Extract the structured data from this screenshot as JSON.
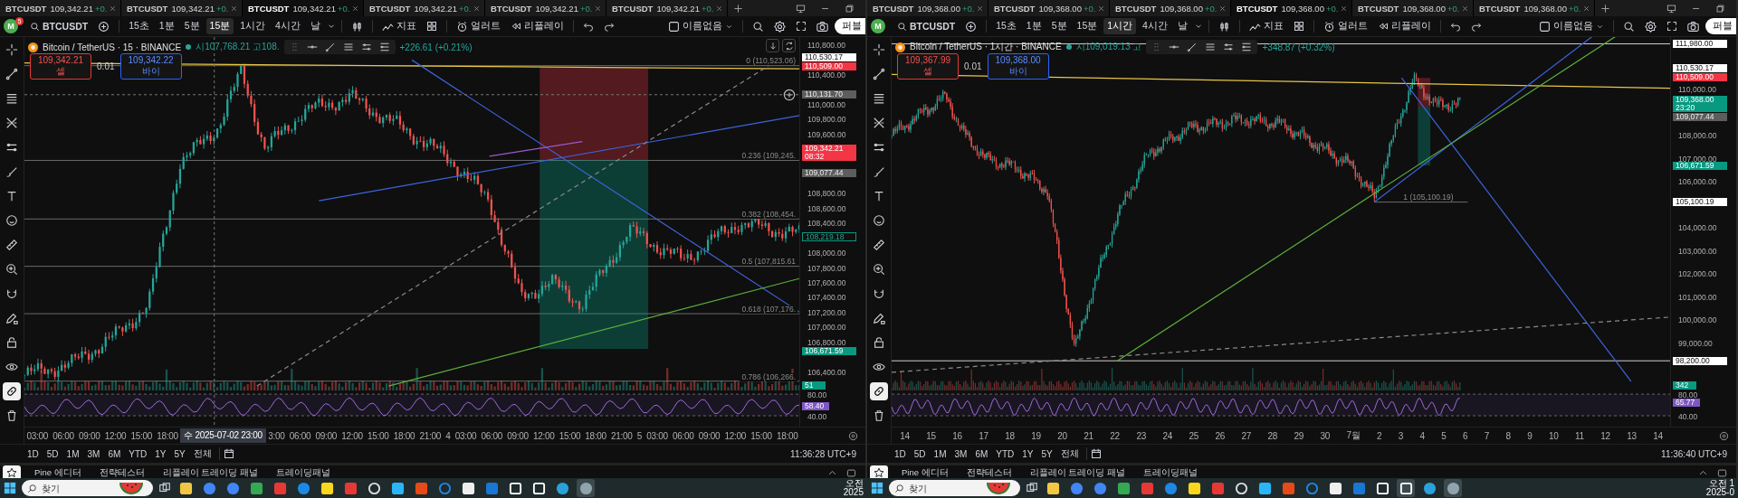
{
  "panes": [
    {
      "tabs": [
        {
          "symbol": "BTCUSDT",
          "price": "109,342.21",
          "change": "+0.",
          "selected": false
        },
        {
          "symbol": "BTCUSDT",
          "price": "109,342.21",
          "change": "+0.",
          "selected": false
        },
        {
          "symbol": "BTCUSDT",
          "price": "109,342.21",
          "change": "+0.",
          "selected": true
        },
        {
          "symbol": "BTCUSDT",
          "price": "109,342.21",
          "change": "+0.",
          "selected": false
        },
        {
          "symbol": "BTCUSDT",
          "price": "109,342.21",
          "change": "+0.",
          "selected": false
        },
        {
          "symbol": "BTCUSDT",
          "price": "109,342.21",
          "change": "+0.",
          "selected": false
        }
      ],
      "toolbar": {
        "avatar": "M",
        "badge": "5",
        "symbol": "BTCUSDT",
        "indicators": "지표",
        "alerts": "얼러트",
        "replay": "리플레이",
        "layout_name": "이름없음",
        "publish": "퍼블",
        "intervals": [
          {
            "label": "15초",
            "selected": false
          },
          {
            "label": "1분",
            "selected": false
          },
          {
            "label": "5분",
            "selected": false
          },
          {
            "label": "15분",
            "selected": true
          },
          {
            "label": "1시간",
            "selected": false
          },
          {
            "label": "4시간",
            "selected": false
          },
          {
            "label": "날",
            "selected": false
          }
        ]
      },
      "tools": [
        {
          "kind": "crosshair",
          "selected": false
        },
        {
          "kind": "line",
          "selected": false
        },
        {
          "kind": "fib",
          "selected": false
        },
        {
          "kind": "pitchfork",
          "selected": false
        },
        {
          "kind": "channel",
          "selected": false
        },
        {
          "kind": "brush",
          "selected": false
        },
        {
          "kind": "text",
          "selected": false
        },
        {
          "kind": "emoji",
          "selected": false
        },
        {
          "kind": "ruler",
          "selected": false
        },
        {
          "kind": "zoom",
          "selected": false
        },
        {
          "kind": "magnet",
          "selected": false
        },
        {
          "kind": "pencil",
          "selected": false
        },
        {
          "kind": "lock",
          "selected": false
        },
        {
          "kind": "eye",
          "selected": false
        },
        {
          "kind": "link",
          "selected": true
        },
        {
          "kind": "trash",
          "selected": false
        }
      ],
      "legend": {
        "title": "Bitcoin / TetherUS · 15 · BINANCE",
        "ohlc": "시107,768.21 고108.",
        "change": "+226.61 (+0.21%)"
      },
      "orders": {
        "sell_price": "109,342.21",
        "sell_label": "셀",
        "quantity": "0.01",
        "buy_price": "109,342.22",
        "buy_label": "바이"
      },
      "fib_labels": [
        {
          "text": "0 (110,523.06)"
        },
        {
          "text": "0.236 (109,245."
        },
        {
          "text": "0.382 (108,454."
        },
        {
          "text": "0.5 (107,815.61"
        },
        {
          "text": "0.618 (107,176."
        },
        {
          "text": "0.786 (106,266."
        }
      ],
      "price_ticks": [
        "110,800.00",
        "110,400.00",
        "110,000.00",
        "109,800.00",
        "109,600.00",
        "108,800.00",
        "108,600.00",
        "108,400.00",
        "108,000.00",
        "107,800.00",
        "107,600.00",
        "107,400.00",
        "107,200.00",
        "107,000.00",
        "106,800.00",
        "106,400.00"
      ],
      "price_labels": [
        {
          "text": "110,530.17",
          "kind": "white"
        },
        {
          "text": "110,509.00",
          "kind": "red"
        },
        {
          "text": "110,131.70",
          "kind": "gray"
        },
        {
          "text": "109,342.21",
          "sub": "08:32",
          "kind": "red"
        },
        {
          "text": "109,077.44",
          "kind": "gray"
        },
        {
          "text": "108,219.18",
          "kind": "outline"
        },
        {
          "text": "106,671.59",
          "kind": "green"
        }
      ],
      "volume_label": "51",
      "rsi": {
        "ticks": [
          "80.00",
          "40.00"
        ],
        "value": "58.40"
      },
      "time_axis": [
        {
          "text": "03:00",
          "kind": "tick"
        },
        {
          "text": "06:00",
          "kind": "tick"
        },
        {
          "text": "09:00",
          "kind": "tick"
        },
        {
          "text": "12:00",
          "kind": "tick"
        },
        {
          "text": "15:00",
          "kind": "tick"
        },
        {
          "text": "18:00",
          "kind": "tick"
        },
        {
          "text": "수 2025-07-02  23:00",
          "kind": "crosshair"
        },
        {
          "text": "3:00",
          "kind": "tick"
        },
        {
          "text": "06:00",
          "kind": "tick"
        },
        {
          "text": "09:00",
          "kind": "tick"
        },
        {
          "text": "12:00",
          "kind": "tick"
        },
        {
          "text": "15:00",
          "kind": "tick"
        },
        {
          "text": "18:00",
          "kind": "tick"
        },
        {
          "text": "21:00",
          "kind": "tick"
        },
        {
          "text": "4",
          "kind": "tick"
        },
        {
          "text": "03:00",
          "kind": "tick"
        },
        {
          "text": "06:00",
          "kind": "tick"
        },
        {
          "text": "09:00",
          "kind": "tick"
        },
        {
          "text": "12:00",
          "kind": "tick"
        },
        {
          "text": "15:00",
          "kind": "tick"
        },
        {
          "text": "18:00",
          "kind": "tick"
        },
        {
          "text": "21:00",
          "kind": "tick"
        },
        {
          "text": "5",
          "kind": "tick"
        },
        {
          "text": "03:00",
          "kind": "tick"
        },
        {
          "text": "06:00",
          "kind": "tick"
        },
        {
          "text": "09:00",
          "kind": "tick"
        },
        {
          "text": "12:00",
          "kind": "tick"
        },
        {
          "text": "15:00",
          "kind": "tick"
        },
        {
          "text": "18:00",
          "kind": "tick"
        }
      ],
      "ranges": [
        "1D",
        "5D",
        "1M",
        "3M",
        "6M",
        "YTD",
        "1Y",
        "5Y",
        "전체"
      ],
      "clock": "11:36:28 UTC+9",
      "panel_tabs": [
        "Pine 에디터",
        "전략테스터",
        "리플레이 트레이딩 패널",
        "트레이딩패널"
      ],
      "taskbar": {
        "search_placeholder": "찾기",
        "time": "오전",
        "date": "2025",
        "apps": [
          {
            "selected": false
          },
          {
            "selected": false
          },
          {
            "selected": false
          },
          {
            "selected": false
          },
          {
            "selected": false
          },
          {
            "selected": false
          },
          {
            "selected": false
          },
          {
            "selected": false
          },
          {
            "selected": false
          },
          {
            "selected": false
          },
          {
            "selected": false
          },
          {
            "selected": false
          },
          {
            "selected": false
          },
          {
            "selected": false
          },
          {
            "selected": false
          },
          {
            "selected": false
          },
          {
            "selected": false
          },
          {
            "selected": true
          }
        ]
      }
    },
    {
      "tabs": [
        {
          "symbol": "BTCUSDT",
          "price": "109,368.00",
          "change": "+0.",
          "selected": false
        },
        {
          "symbol": "BTCUSDT",
          "price": "109,368.00",
          "change": "+0.",
          "selected": false
        },
        {
          "symbol": "BTCUSDT",
          "price": "109,368.00",
          "change": "+0.",
          "selected": false
        },
        {
          "symbol": "BTCUSDT",
          "price": "109,368.00",
          "change": "+0.",
          "selected": true
        },
        {
          "symbol": "BTCUSDT",
          "price": "109,368.00",
          "change": "+0.",
          "selected": false
        },
        {
          "symbol": "BTCUSDT",
          "price": "109,368.00",
          "change": "+0.",
          "selected": false
        }
      ],
      "toolbar": {
        "avatar": "M",
        "symbol": "BTCUSDT",
        "indicators": "지표",
        "alerts": "얼러트",
        "replay": "리플레이",
        "layout_name": "이름없음",
        "publish": "퍼블",
        "intervals": [
          {
            "label": "15초",
            "selected": false
          },
          {
            "label": "1분",
            "selected": false
          },
          {
            "label": "5분",
            "selected": false
          },
          {
            "label": "15분",
            "selected": false
          },
          {
            "label": "1시간",
            "selected": true
          },
          {
            "label": "4시간",
            "selected": false
          },
          {
            "label": "날",
            "selected": false
          }
        ]
      },
      "tools": [
        {
          "kind": "crosshair",
          "selected": false
        },
        {
          "kind": "line",
          "selected": false
        },
        {
          "kind": "fib",
          "selected": false
        },
        {
          "kind": "pitchfork",
          "selected": false
        },
        {
          "kind": "channel",
          "selected": false
        },
        {
          "kind": "brush",
          "selected": false
        },
        {
          "kind": "text",
          "selected": false
        },
        {
          "kind": "emoji",
          "selected": false
        },
        {
          "kind": "ruler",
          "selected": false
        },
        {
          "kind": "zoom",
          "selected": false
        },
        {
          "kind": "magnet",
          "selected": false
        },
        {
          "kind": "pencil",
          "selected": false
        },
        {
          "kind": "lock",
          "selected": false
        },
        {
          "kind": "eye",
          "selected": false
        },
        {
          "kind": "link",
          "selected": true
        },
        {
          "kind": "trash",
          "selected": false
        }
      ],
      "legend": {
        "title": "Bitcoin / TetherUS · 1시간 · BINANCE",
        "ohlc": "시109,019.13 고",
        "change": "+348.87 (+0.32%)"
      },
      "orders": {
        "sell_price": "109,367.99",
        "sell_label": "셀",
        "quantity": "0.01",
        "buy_price": "109,368.00",
        "buy_label": "바이"
      },
      "fib_labels": [
        {
          "text": "1 (105,100.19)"
        }
      ],
      "price_ticks": [
        "110,000.00",
        "108,000.00",
        "107,000.00",
        "106,000.00",
        "104,000.00",
        "103,000.00",
        "102,000.00",
        "101,000.00",
        "100,000.00",
        "99,000.00"
      ],
      "price_labels": [
        {
          "text": "111,980.00",
          "kind": "white"
        },
        {
          "text": "110,530.17",
          "kind": "white"
        },
        {
          "text": "110,509.00",
          "kind": "red"
        },
        {
          "text": "109,368.00",
          "sub": "23:20",
          "kind": "green"
        },
        {
          "text": "109,077.44",
          "kind": "gray"
        },
        {
          "text": "106,671.59",
          "kind": "green"
        },
        {
          "text": "105,100.19",
          "kind": "white"
        },
        {
          "text": "98,200.00",
          "kind": "white"
        }
      ],
      "volume_label": "342",
      "rsi": {
        "ticks": [
          "80.00",
          "40.00"
        ],
        "value": "65.77"
      },
      "time_axis": [
        {
          "text": "14",
          "kind": "tick"
        },
        {
          "text": "15",
          "kind": "tick"
        },
        {
          "text": "16",
          "kind": "tick"
        },
        {
          "text": "17",
          "kind": "tick"
        },
        {
          "text": "18",
          "kind": "tick"
        },
        {
          "text": "19",
          "kind": "tick"
        },
        {
          "text": "20",
          "kind": "tick"
        },
        {
          "text": "21",
          "kind": "tick"
        },
        {
          "text": "22",
          "kind": "tick"
        },
        {
          "text": "23",
          "kind": "tick"
        },
        {
          "text": "24",
          "kind": "tick"
        },
        {
          "text": "25",
          "kind": "tick"
        },
        {
          "text": "26",
          "kind": "tick"
        },
        {
          "text": "27",
          "kind": "tick"
        },
        {
          "text": "28",
          "kind": "tick"
        },
        {
          "text": "29",
          "kind": "tick"
        },
        {
          "text": "30",
          "kind": "tick"
        },
        {
          "text": "7월",
          "kind": "tick"
        },
        {
          "text": "2",
          "kind": "tick"
        },
        {
          "text": "3",
          "kind": "tick"
        },
        {
          "text": "4",
          "kind": "tick"
        },
        {
          "text": "5",
          "kind": "tick"
        },
        {
          "text": "6",
          "kind": "tick"
        },
        {
          "text": "7",
          "kind": "tick"
        },
        {
          "text": "8",
          "kind": "tick"
        },
        {
          "text": "9",
          "kind": "tick"
        },
        {
          "text": "10",
          "kind": "tick"
        },
        {
          "text": "11",
          "kind": "tick"
        },
        {
          "text": "12",
          "kind": "tick"
        },
        {
          "text": "13",
          "kind": "tick"
        },
        {
          "text": "14",
          "kind": "tick"
        }
      ],
      "ranges": [
        "1D",
        "5D",
        "1M",
        "3M",
        "6M",
        "YTD",
        "1Y",
        "5Y",
        "전체"
      ],
      "clock": "11:36:40 UTC+9",
      "panel_tabs": [
        "Pine 에디터",
        "전략테스터",
        "리플레이 트레이딩 패널",
        "트레이딩패널"
      ],
      "taskbar": {
        "search_placeholder": "찾기",
        "time": "오전 1",
        "date": "2025-0",
        "apps": [
          {
            "selected": false
          },
          {
            "selected": false
          },
          {
            "selected": false
          },
          {
            "selected": false
          },
          {
            "selected": false
          },
          {
            "selected": false
          },
          {
            "selected": false
          },
          {
            "selected": false
          },
          {
            "selected": false
          },
          {
            "selected": false
          },
          {
            "selected": false
          },
          {
            "selected": false
          },
          {
            "selected": false
          },
          {
            "selected": false
          },
          {
            "selected": false
          },
          {
            "selected": true
          },
          {
            "selected": false
          },
          {
            "selected": true
          }
        ]
      }
    }
  ]
}
